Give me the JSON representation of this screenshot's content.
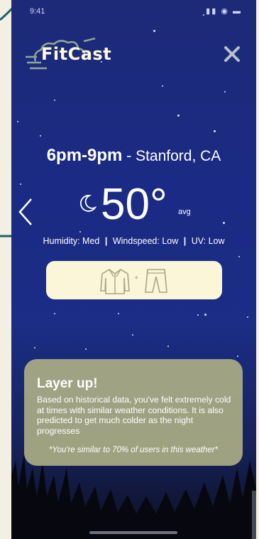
{
  "app": {
    "name": "FitCast"
  },
  "statusbar": {
    "time": "9:41",
    "indicators": "▮▮ ◉ ▬"
  },
  "forecast": {
    "time_range": "6pm-9pm",
    "separator": " - ",
    "location": "Stanford, CA",
    "temperature": "50°",
    "temperature_qualifier": "avg",
    "humidity_label": "Humidity: Med",
    "windspeed_label": "Windspeed: Low",
    "uv_label": "UV: Low",
    "condition_separator": "|"
  },
  "outfit": {
    "top": "jacket-icon",
    "bottom": "pants-icon",
    "joiner": "+"
  },
  "advice": {
    "title": "Layer up!",
    "body": "Based on historical data, you've felt extremely cold at times with similar weather conditions. It is also predicted to get much colder as the night progresses",
    "footnote": "*You're similar to 70% of users in this weather*"
  },
  "colors": {
    "sky_top": "#1d2a78",
    "sky_bottom": "#0c0f20",
    "card_cream": "#fbf6d8",
    "advice_card": "#aaac84",
    "page_background": "#f4efe3",
    "annotation_teal": "#1f5f6a"
  }
}
